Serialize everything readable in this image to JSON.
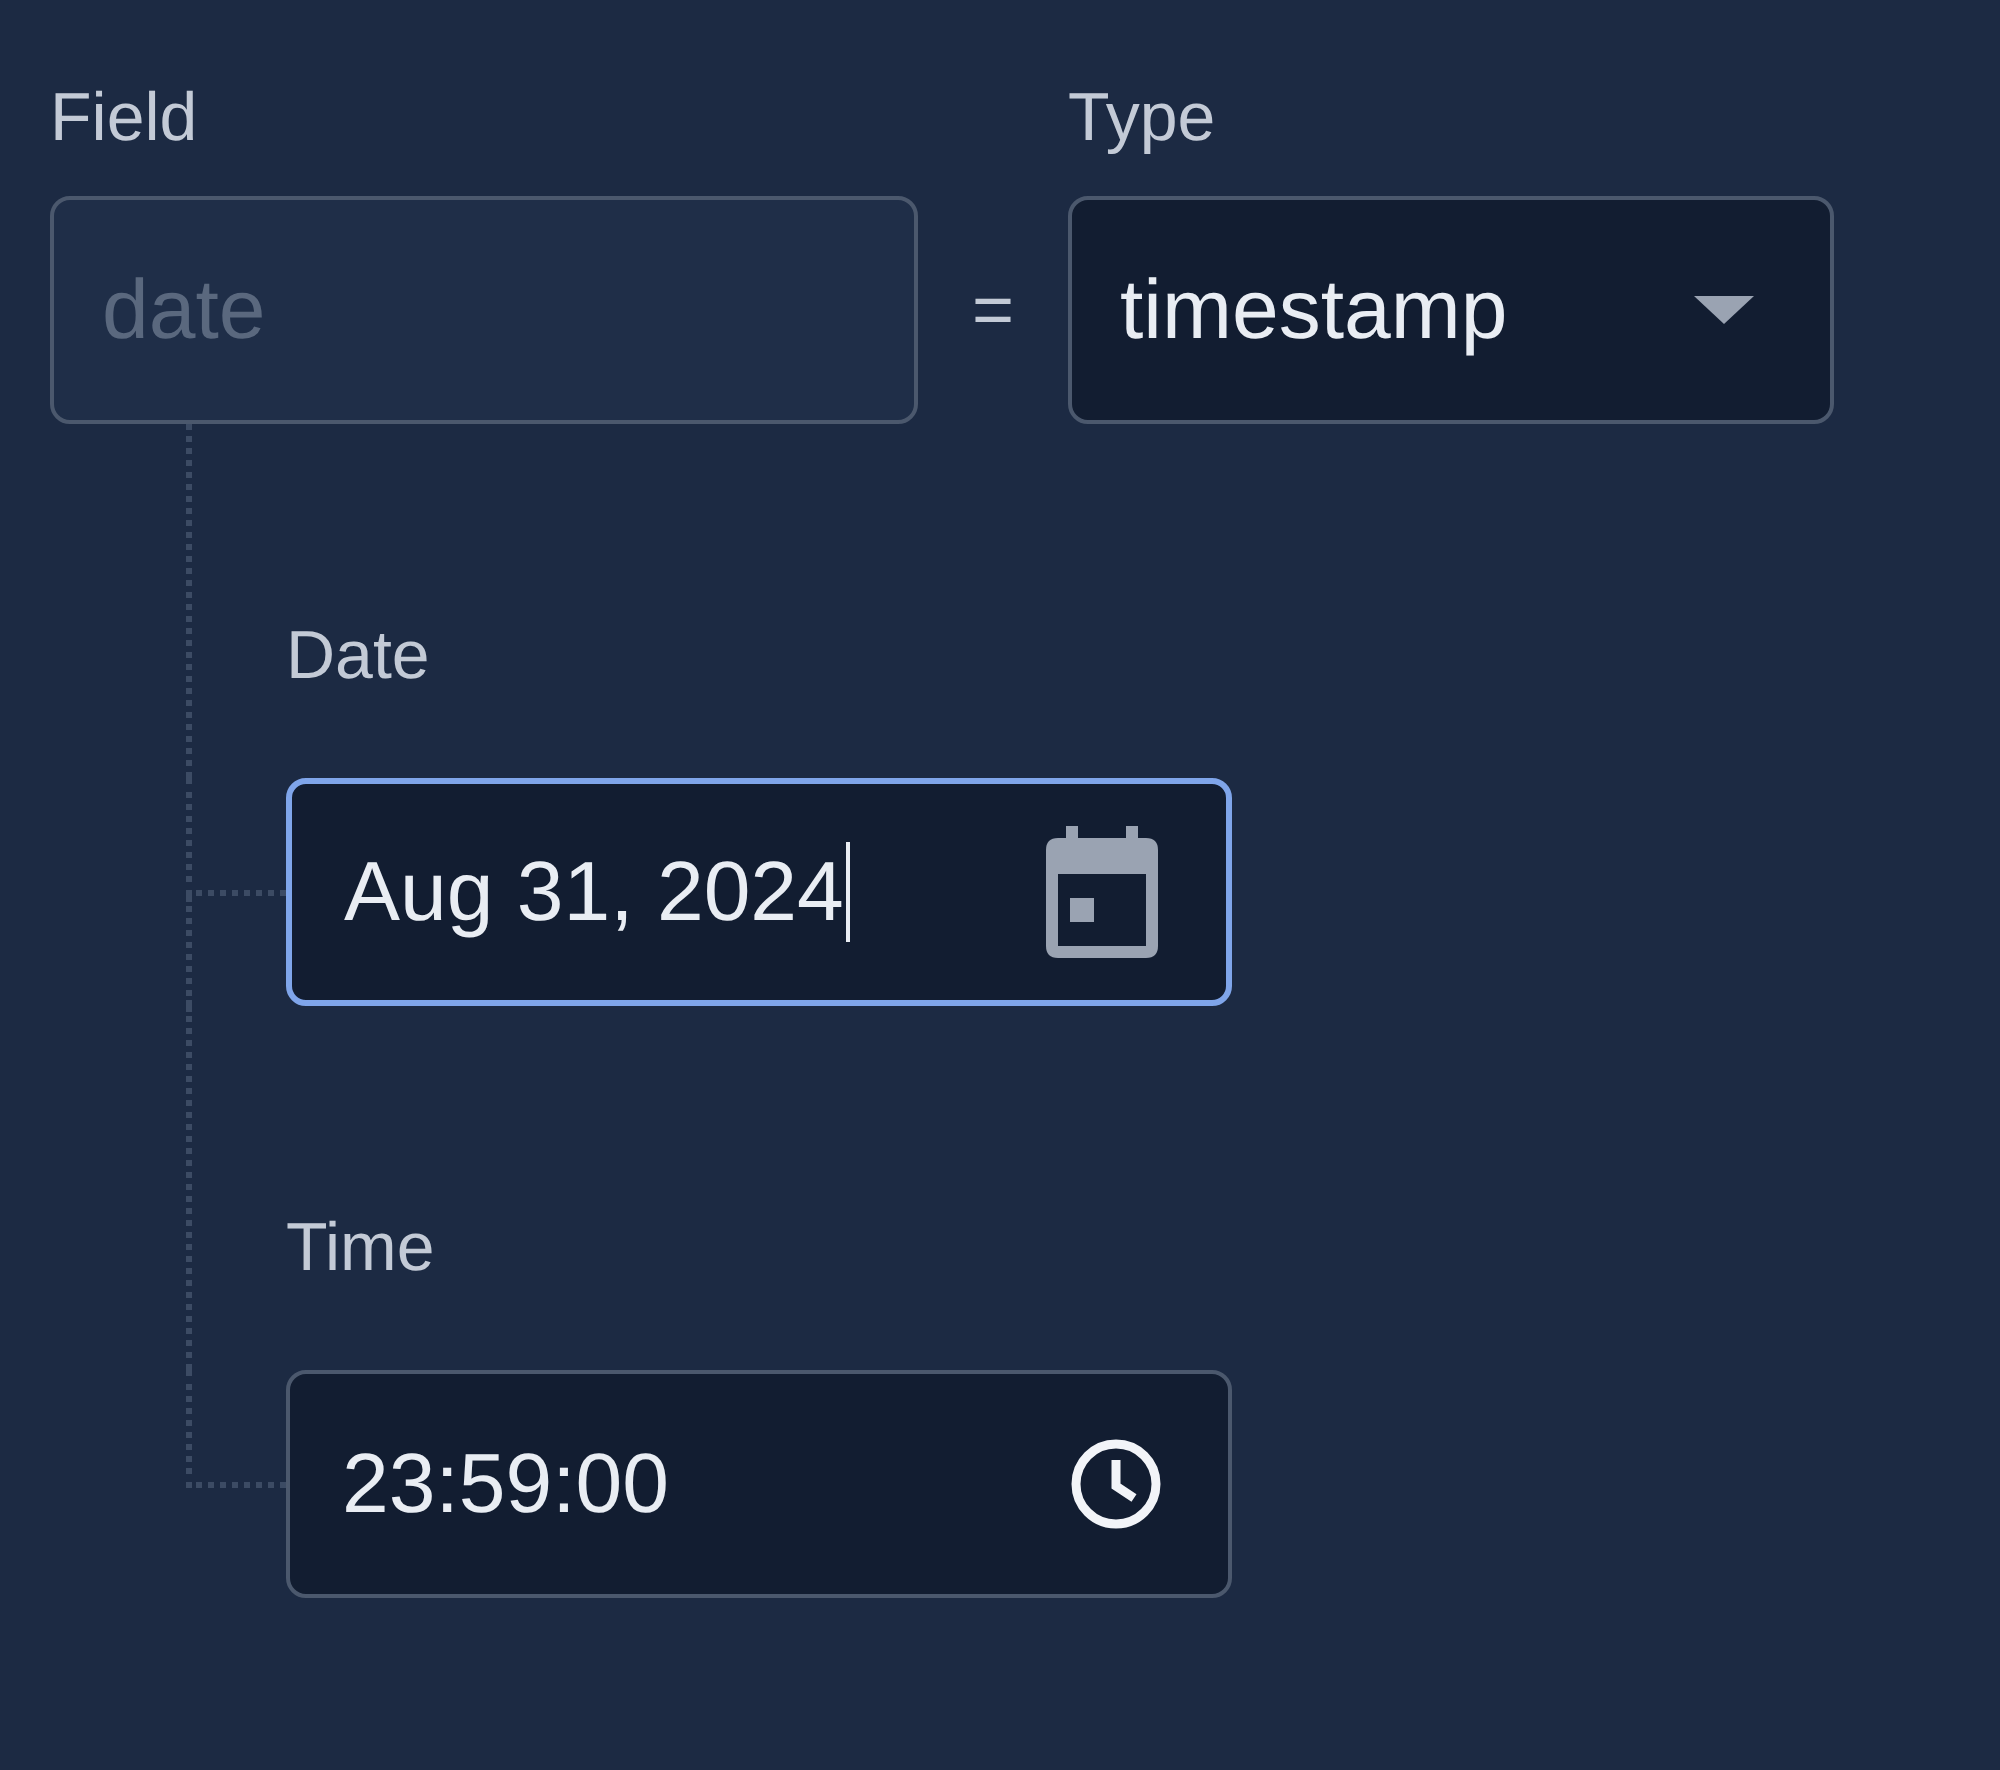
{
  "field": {
    "label": "Field",
    "placeholder": "date"
  },
  "operator": "=",
  "type": {
    "label": "Type",
    "value": "timestamp"
  },
  "subfields": [
    {
      "kind": "date",
      "label": "Date",
      "value": "Aug 31, 2024",
      "focused": true
    },
    {
      "kind": "time",
      "label": "Time",
      "value": "23:59:00",
      "focused": false
    }
  ]
}
